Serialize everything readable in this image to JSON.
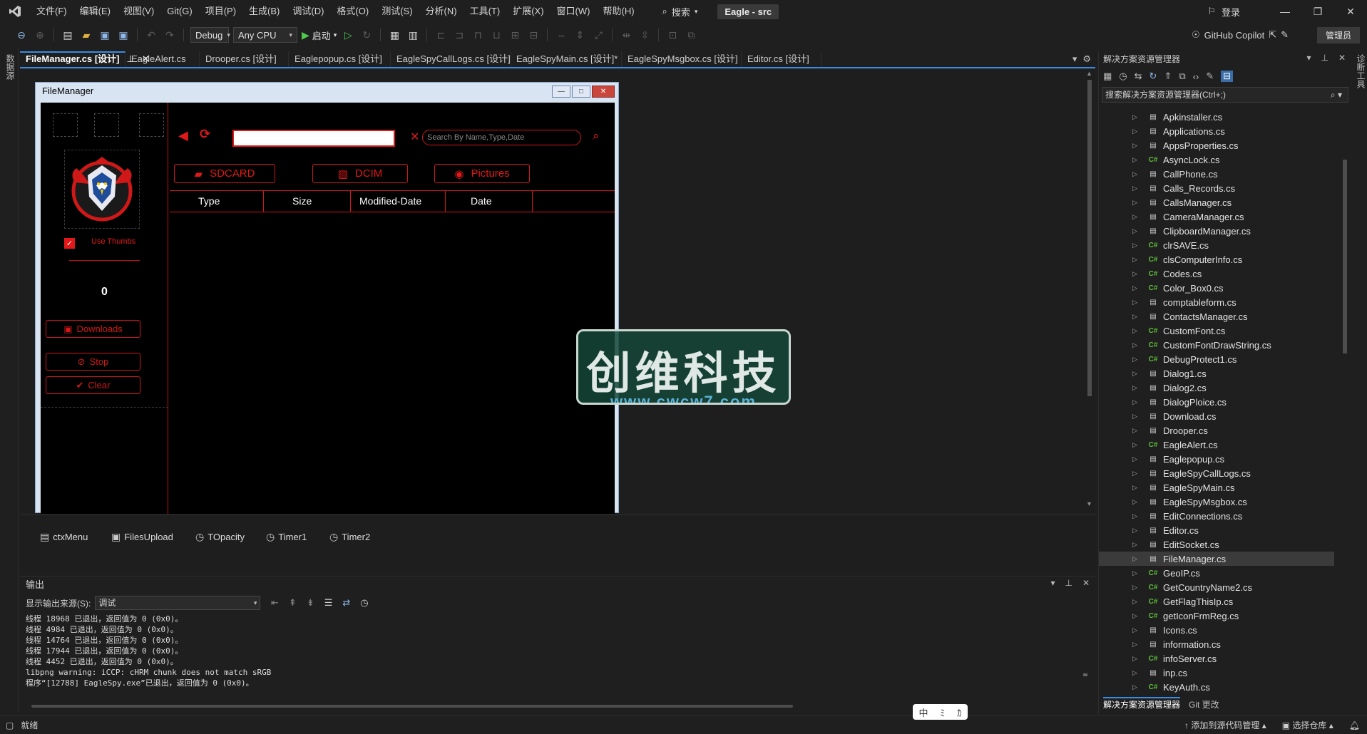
{
  "menubar": {
    "items": [
      "文件(F)",
      "编辑(E)",
      "视图(V)",
      "Git(G)",
      "项目(P)",
      "生成(B)",
      "调试(D)",
      "格式(O)",
      "测试(S)",
      "分析(N)",
      "工具(T)",
      "扩展(X)",
      "窗口(W)",
      "帮助(H)"
    ],
    "search_label": "搜索",
    "solution_title": "Eagle - src",
    "login_label": "登录"
  },
  "toolbar": {
    "config": "Debug",
    "platform": "Any CPU",
    "start_label": "启动",
    "copilot_label": "GitHub Copilot",
    "admin_label": "管理员"
  },
  "left_strip_label": "数据源",
  "right_strip_label": "诊断工具",
  "doc_tabs": [
    {
      "label": "FileManager.cs [设计]",
      "active": true
    },
    {
      "label": "EagleAlert.cs",
      "active": false
    },
    {
      "label": "Drooper.cs [设计]",
      "active": false
    },
    {
      "label": "Eaglepopup.cs [设计]",
      "active": false
    },
    {
      "label": "EagleSpyCallLogs.cs [设计]",
      "active": false
    },
    {
      "label": "EagleSpyMain.cs [设计]*",
      "active": false
    },
    {
      "label": "EagleSpyMsgbox.cs [设计]",
      "active": false
    },
    {
      "label": "Editor.cs [设计]",
      "active": false
    }
  ],
  "form": {
    "title": "FileManager",
    "use_thumbs_label": "Use Thumbs",
    "use_thumbs_checked": true,
    "counter": "0",
    "downloads_label": "Downloads",
    "stop_label": "Stop",
    "clear_label": "Clear",
    "search_placeholder": "Search By Name,Type,Date",
    "path_value": "",
    "sdcard_label": "SDCARD",
    "dcim_label": "DCIM",
    "pictures_label": "Pictures",
    "columns": [
      "Type",
      "Size",
      "Modified-Date",
      "Date"
    ]
  },
  "components": [
    "ctxMenu",
    "FilesUpload",
    "TOpacity",
    "Timer1",
    "Timer2"
  ],
  "output": {
    "title": "输出",
    "source_label": "显示输出来源(S):",
    "source_value": "调试",
    "lines": [
      "线程 18968 已退出，返回值为 0 (0x0)。",
      "线程 4984 已退出，返回值为 0 (0x0)。",
      "线程 14764 已退出，返回值为 0 (0x0)。",
      "线程 17944 已退出，返回值为 0 (0x0)。",
      "线程 4452 已退出，返回值为 0 (0x0)。",
      "libpng warning: iCCP: cHRM chunk does not match sRGB",
      "程序“[12788] EagleSpy.exe”已退出，返回值为 0 (0x0)。"
    ]
  },
  "solution": {
    "title": "解决方案资源管理器",
    "search_placeholder": "搜索解决方案资源管理器(Ctrl+;)",
    "files": [
      {
        "name": "Apkinstaller.cs",
        "type": "form"
      },
      {
        "name": "Applications.cs",
        "type": "form"
      },
      {
        "name": "AppsProperties.cs",
        "type": "form"
      },
      {
        "name": "AsyncLock.cs",
        "type": "cs"
      },
      {
        "name": "CallPhone.cs",
        "type": "form"
      },
      {
        "name": "Calls_Records.cs",
        "type": "form"
      },
      {
        "name": "CallsManager.cs",
        "type": "form"
      },
      {
        "name": "CameraManager.cs",
        "type": "form"
      },
      {
        "name": "ClipboardManager.cs",
        "type": "form"
      },
      {
        "name": "clrSAVE.cs",
        "type": "cs"
      },
      {
        "name": "clsComputerInfo.cs",
        "type": "cs"
      },
      {
        "name": "Codes.cs",
        "type": "cs"
      },
      {
        "name": "Color_Box0.cs",
        "type": "cs"
      },
      {
        "name": "comptableform.cs",
        "type": "form"
      },
      {
        "name": "ContactsManager.cs",
        "type": "form"
      },
      {
        "name": "CustomFont.cs",
        "type": "cs"
      },
      {
        "name": "CustomFontDrawString.cs",
        "type": "cs"
      },
      {
        "name": "DebugProtect1.cs",
        "type": "cs"
      },
      {
        "name": "Dialog1.cs",
        "type": "form"
      },
      {
        "name": "Dialog2.cs",
        "type": "form"
      },
      {
        "name": "DialogPloice.cs",
        "type": "form"
      },
      {
        "name": "Download.cs",
        "type": "form"
      },
      {
        "name": "Drooper.cs",
        "type": "form"
      },
      {
        "name": "EagleAlert.cs",
        "type": "cs"
      },
      {
        "name": "Eaglepopup.cs",
        "type": "form"
      },
      {
        "name": "EagleSpyCallLogs.cs",
        "type": "form"
      },
      {
        "name": "EagleSpyMain.cs",
        "type": "form"
      },
      {
        "name": "EagleSpyMsgbox.cs",
        "type": "form"
      },
      {
        "name": "EditConnections.cs",
        "type": "form"
      },
      {
        "name": "Editor.cs",
        "type": "form"
      },
      {
        "name": "EditSocket.cs",
        "type": "form"
      },
      {
        "name": "FileManager.cs",
        "type": "form",
        "selected": true
      },
      {
        "name": "GeoIP.cs",
        "type": "cs"
      },
      {
        "name": "GetCountryName2.cs",
        "type": "cs"
      },
      {
        "name": "GetFlagThisIp.cs",
        "type": "cs"
      },
      {
        "name": "getIconFrmReg.cs",
        "type": "cs"
      },
      {
        "name": "Icons.cs",
        "type": "form"
      },
      {
        "name": "information.cs",
        "type": "form"
      },
      {
        "name": "infoServer.cs",
        "type": "cs"
      },
      {
        "name": "inp.cs",
        "type": "form"
      },
      {
        "name": "KeyAuth.cs",
        "type": "cs"
      }
    ],
    "bottom_tabs": [
      "解决方案资源管理器",
      "Git 更改"
    ]
  },
  "statusbar": {
    "ready": "就绪",
    "add_source": "添加到源代码管理",
    "select_repo": "选择仓库"
  },
  "watermark": {
    "text": "创维科技",
    "url": "www.cwcw7.com"
  },
  "ime": [
    "中",
    "ﾐ",
    "ｶ"
  ],
  "colors": {
    "accent_red": "#e01818",
    "vs_blue": "#3b8be0",
    "background": "#1f1f1f"
  }
}
